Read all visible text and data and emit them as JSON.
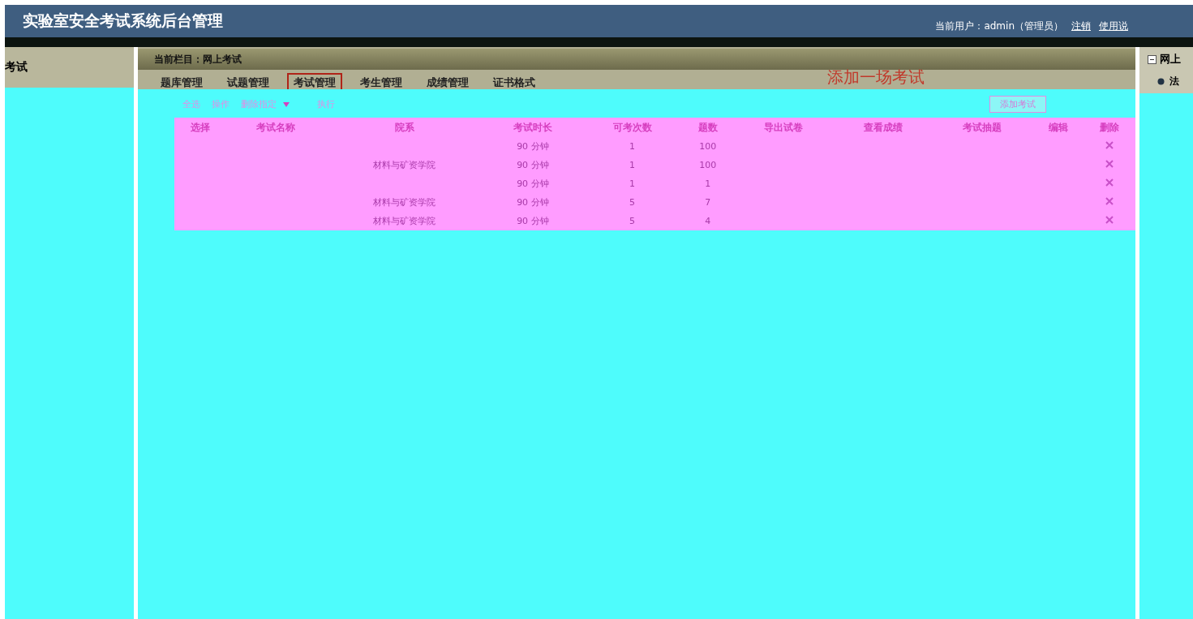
{
  "header": {
    "title": "实验室安全考试系统后台管理",
    "user": "当前用户：admin（管理员）",
    "links": [
      "注销",
      "使用说"
    ]
  },
  "sidebar": {
    "heading": "考试"
  },
  "breadcrumb": "当前栏目：网上考试",
  "tabs": [
    {
      "label": "题库管理",
      "selected": false
    },
    {
      "label": "试题管理",
      "selected": false
    },
    {
      "label": "考试管理",
      "selected": true
    },
    {
      "label": "考生管理",
      "selected": false
    },
    {
      "label": "成绩管理",
      "selected": false
    },
    {
      "label": "证书格式",
      "selected": false
    }
  ],
  "page_title": "添加一场考试",
  "toolbar": {
    "select_all": "全选",
    "action_label": "操作",
    "action_dropdown": "删除指定",
    "execute": "执行",
    "add_button": "添加考试"
  },
  "table": {
    "columns": [
      "选择",
      "考试名称",
      "院系",
      "考试时长",
      "可考次数",
      "题数",
      "导出试卷",
      "查看成绩",
      "考试抽题",
      "编辑",
      "删除"
    ],
    "rows": [
      {
        "duration": "90 分钟",
        "attempts": "1",
        "questions": "100"
      },
      {
        "department": "材料与矿资学院",
        "duration": "90 分钟",
        "attempts": "1",
        "questions": "100"
      },
      {
        "duration": "90 分钟",
        "attempts": "1",
        "questions": "1"
      },
      {
        "department": "材料与矿资学院",
        "duration": "90 分钟",
        "attempts": "5",
        "questions": "7"
      },
      {
        "department": "材料与矿资学院",
        "duration": "90 分钟",
        "attempts": "5",
        "questions": "4"
      }
    ]
  },
  "right_panel": {
    "heading": "网上",
    "items": [
      "法"
    ]
  }
}
